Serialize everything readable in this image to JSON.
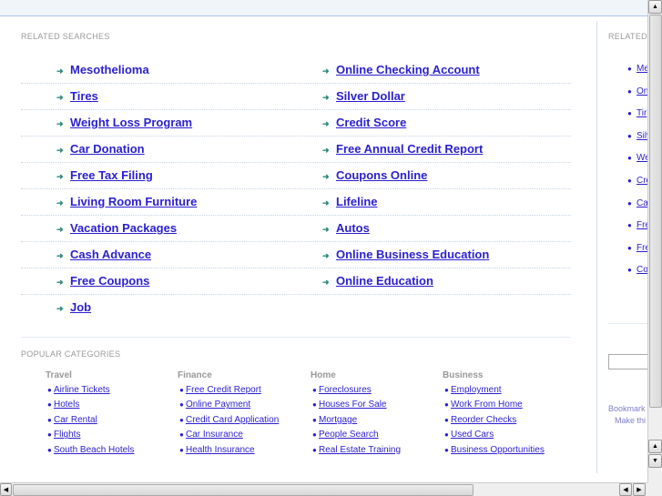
{
  "related_searches": {
    "label": "RELATED SEARCHES",
    "left": [
      "Mesothelioma",
      "Tires",
      "Weight Loss Program",
      "Car Donation",
      "Free Tax Filing",
      "Living Room Furniture",
      "Vacation Packages",
      "Cash Advance",
      "Free Coupons",
      "Job"
    ],
    "right": [
      "Online Checking Account",
      "Silver Dollar",
      "Credit Score",
      "Free Annual Credit Report",
      "Coupons Online",
      "Lifeline",
      "Autos",
      "Online Business Education",
      "Online Education"
    ]
  },
  "popular_categories": {
    "label": "POPULAR CATEGORIES",
    "columns": [
      {
        "title": "Travel",
        "links": [
          "Airline Tickets",
          "Hotels",
          "Car Rental",
          "Flights",
          "South Beach Hotels"
        ]
      },
      {
        "title": "Finance",
        "links": [
          "Free Credit Report",
          "Online Payment",
          "Credit Card Application",
          "Car Insurance",
          "Health Insurance"
        ]
      },
      {
        "title": "Home",
        "links": [
          "Foreclosures",
          "Houses For Sale",
          "Mortgage",
          "People Search",
          "Real Estate Training"
        ]
      },
      {
        "title": "Business",
        "links": [
          "Employment",
          "Work From Home",
          "Reorder Checks",
          "Used Cars",
          "Business Opportunities"
        ]
      }
    ]
  },
  "sidebar": {
    "label": "RELATED",
    "links": [
      "Me",
      "On",
      "Tir",
      "Silv",
      "We",
      "Cre",
      "Ca",
      "Fre",
      "Fre",
      "Co"
    ],
    "bookmark": "Bookmark",
    "make": "Make thi"
  }
}
